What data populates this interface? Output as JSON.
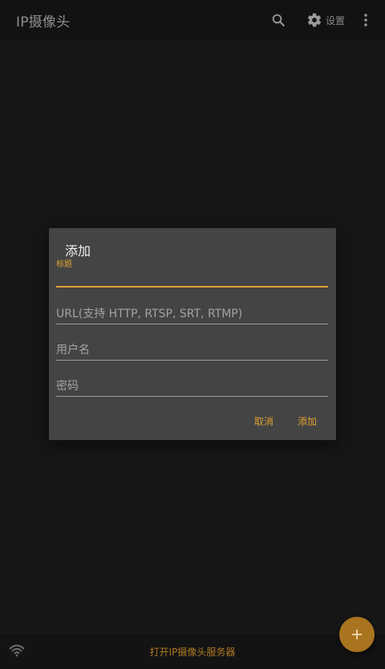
{
  "appbar": {
    "title": "IP摄像头",
    "settings_label": "设置"
  },
  "dialog": {
    "title": "添加",
    "fields": {
      "title_label": "标题",
      "url_placeholder": "URL(支持 HTTP, RTSP, SRT, RTMP)",
      "username_placeholder": "用户名",
      "password_placeholder": "密码"
    },
    "cancel_label": "取消",
    "add_label": "添加"
  },
  "bottombar": {
    "server_link": "打开IP摄像头服务器"
  },
  "icons": {
    "search": "search-icon",
    "settings": "gear-icon",
    "more": "more-vert-icon",
    "wifi": "wifi-icon",
    "add": "plus-icon"
  },
  "colors": {
    "accent": "#e0a032",
    "fab": "#a8741f",
    "dialog_bg": "#444444",
    "background": "#161616"
  }
}
